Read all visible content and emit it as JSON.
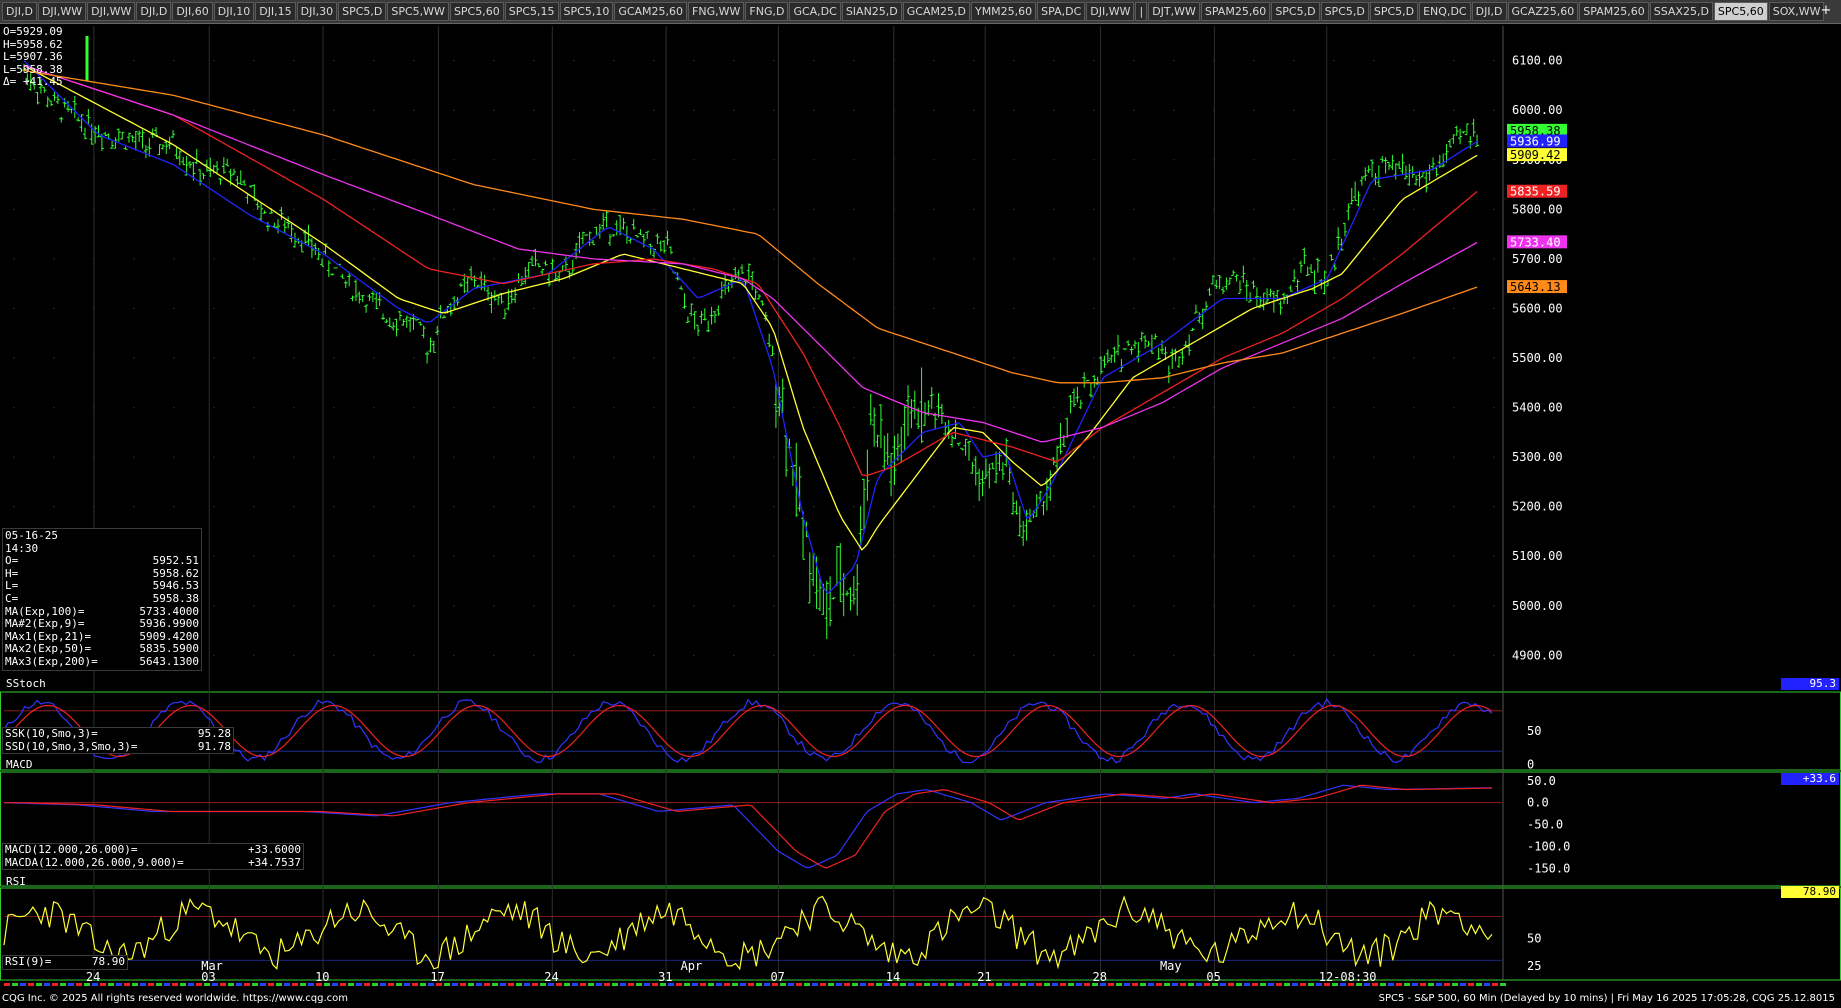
{
  "tabs": [
    "DJI,D",
    "DJI,WW",
    "DJI,WW",
    "DJI,D",
    "DJI,60",
    "DJI,10",
    "DJI,15",
    "DJI,30",
    "SPC5,D",
    "SPC5,WW",
    "SPC5,60",
    "SPC5,15",
    "SPC5,10",
    "GCAM25,60",
    "FNG,WW",
    "FNG,D",
    "GCA,DC",
    "SIAN25,D",
    "GCAM25,D",
    "YMM25,60",
    "SPA,DC",
    "DJI,WW",
    "|",
    "DJT,WW",
    "SPAM25,60",
    "SPC5,D",
    "SPC5,D",
    "SPC5,D",
    "ENQ,DC",
    "DJI,D",
    "GCAZ25,60",
    "SPAM25,60",
    "SSAX25,D",
    "SPC5,60",
    "SOX,WW"
  ],
  "active_tab_index": 33,
  "add_tab_label": "+",
  "header_ohlc": {
    "o": "O=5929.09",
    "h": "H=5958.62",
    "l": "L=5907.36",
    "l2": "L=5958.38",
    "delta": "Δ= +41.45"
  },
  "cursor_box": {
    "date": "05-16-25",
    "time": "14:30",
    "rows": [
      [
        "O=",
        "5952.51"
      ],
      [
        "H=",
        "5958.62"
      ],
      [
        "L=",
        "5946.53"
      ],
      [
        "C=",
        "5958.38"
      ],
      [
        "MA(Exp,100)=",
        "5733.4000"
      ],
      [
        "MA#2(Exp,9)=",
        "5936.9900"
      ],
      [
        "MAx1(Exp,21)=",
        "5909.4200"
      ],
      [
        "MAx2(Exp,50)=",
        "5835.5900"
      ],
      [
        "MAx3(Exp,200)=",
        "5643.1300"
      ]
    ]
  },
  "stoch_box": {
    "title": "SStoch",
    "rows": [
      [
        "SSK(10,Smo,3)=",
        "95.28"
      ],
      [
        "SSD(10,Smo,3,Smo,3)=",
        "91.78"
      ]
    ],
    "badge": "95.3"
  },
  "macd_box": {
    "title": "MACD",
    "rows": [
      [
        "MACD(12.000,26.000)=",
        "+33.6000"
      ],
      [
        "MACDA(12.000,26.000,9.000)=",
        "+34.7537"
      ]
    ],
    "badge": "+33.6"
  },
  "rsi_box": {
    "title": "RSI",
    "rows": [
      [
        "RSI(9)=",
        "78.90"
      ]
    ],
    "badge": "78.90"
  },
  "footer": {
    "left": "CQG Inc. © 2025 All rights reserved worldwide. https://www.cqg.com",
    "right": "SPC5 - S&P 500, 60 Min (Delayed by 10 mins) | Fri May 16 2025 17:05:28, CQG 25.12.8015"
  },
  "colors": {
    "bars": "#33ff33",
    "ema9": "#2222ff",
    "ema21": "#ffff33",
    "ema50": "#ee2222",
    "ema100": "#ee33ee",
    "ema200": "#ff8a1a",
    "grid": "#3a3a3a",
    "panel_border": "#33cc33"
  },
  "chart_data": [
    {
      "type": "candlestick",
      "name": "price",
      "ylim": [
        4830,
        6170
      ],
      "yticks": [
        4900,
        5000,
        5100,
        5200,
        5300,
        5400,
        5500,
        5600,
        5700,
        5800,
        5900,
        6000,
        6100
      ],
      "ytick_labels": [
        "4900.00",
        "5000.00",
        "5100.00",
        "5200.00",
        "5300.00",
        "5400.00",
        "5500.00",
        "5600.00",
        "5700.00",
        "5800.00",
        "5900.00",
        "6000.00",
        "6100.00"
      ],
      "x_labels": [
        {
          "pos": 0.06,
          "text": "24",
          "row": "lower"
        },
        {
          "pos": 0.137,
          "text": "Mar",
          "row": "upper"
        },
        {
          "pos": 0.137,
          "text": "03",
          "row": "lower"
        },
        {
          "pos": 0.213,
          "text": "10",
          "row": "lower"
        },
        {
          "pos": 0.29,
          "text": "17",
          "row": "lower"
        },
        {
          "pos": 0.366,
          "text": "24",
          "row": "lower"
        },
        {
          "pos": 0.442,
          "text": "31",
          "row": "lower"
        },
        {
          "pos": 0.457,
          "text": "Apr",
          "row": "upper"
        },
        {
          "pos": 0.517,
          "text": "07",
          "row": "lower"
        },
        {
          "pos": 0.594,
          "text": "14",
          "row": "lower"
        },
        {
          "pos": 0.655,
          "text": "21",
          "row": "lower"
        },
        {
          "pos": 0.732,
          "text": "28",
          "row": "lower"
        },
        {
          "pos": 0.777,
          "text": "May",
          "row": "upper"
        },
        {
          "pos": 0.808,
          "text": "05",
          "row": "lower"
        },
        {
          "pos": 0.883,
          "text": "12-08:30",
          "row": "lower"
        }
      ],
      "anchors": [
        [
          0,
          6080
        ],
        [
          0.02,
          6010
        ],
        [
          0.05,
          5960
        ],
        [
          0.08,
          5930
        ],
        [
          0.1,
          5930
        ],
        [
          0.12,
          5870
        ],
        [
          0.14,
          5880
        ],
        [
          0.16,
          5790
        ],
        [
          0.18,
          5760
        ],
        [
          0.2,
          5700
        ],
        [
          0.22,
          5640
        ],
        [
          0.24,
          5590
        ],
        [
          0.26,
          5570
        ],
        [
          0.27,
          5520
        ],
        [
          0.28,
          5590
        ],
        [
          0.3,
          5660
        ],
        [
          0.32,
          5610
        ],
        [
          0.34,
          5690
        ],
        [
          0.36,
          5660
        ],
        [
          0.375,
          5740
        ],
        [
          0.39,
          5770
        ],
        [
          0.41,
          5740
        ],
        [
          0.43,
          5720
        ],
        [
          0.44,
          5610
        ],
        [
          0.45,
          5560
        ],
        [
          0.47,
          5640
        ],
        [
          0.485,
          5670
        ],
        [
          0.495,
          5570
        ],
        [
          0.505,
          5420
        ],
        [
          0.515,
          5250
        ],
        [
          0.525,
          5100
        ],
        [
          0.535,
          4980
        ],
        [
          0.545,
          5050
        ],
        [
          0.555,
          5010
        ],
        [
          0.565,
          5380
        ],
        [
          0.58,
          5270
        ],
        [
          0.595,
          5400
        ],
        [
          0.61,
          5400
        ],
        [
          0.625,
          5330
        ],
        [
          0.64,
          5250
        ],
        [
          0.655,
          5300
        ],
        [
          0.665,
          5160
        ],
        [
          0.675,
          5180
        ],
        [
          0.685,
          5250
        ],
        [
          0.7,
          5400
        ],
        [
          0.72,
          5480
        ],
        [
          0.74,
          5530
        ],
        [
          0.755,
          5540
        ],
        [
          0.765,
          5480
        ],
        [
          0.78,
          5560
        ],
        [
          0.795,
          5650
        ],
        [
          0.81,
          5660
        ],
        [
          0.825,
          5620
        ],
        [
          0.84,
          5610
        ],
        [
          0.855,
          5690
        ],
        [
          0.87,
          5650
        ],
        [
          0.885,
          5810
        ],
        [
          0.9,
          5880
        ],
        [
          0.92,
          5880
        ],
        [
          0.935,
          5860
        ],
        [
          0.95,
          5910
        ],
        [
          0.96,
          5950
        ],
        [
          0.97,
          5958
        ]
      ],
      "ema_series": [
        {
          "key": "ema9",
          "anchors": [
            [
              0,
              6100
            ],
            [
              0.05,
              5950
            ],
            [
              0.1,
              5890
            ],
            [
              0.15,
              5790
            ],
            [
              0.2,
              5710
            ],
            [
              0.25,
              5600
            ],
            [
              0.27,
              5570
            ],
            [
              0.3,
              5640
            ],
            [
              0.35,
              5670
            ],
            [
              0.375,
              5730
            ],
            [
              0.39,
              5765
            ],
            [
              0.42,
              5720
            ],
            [
              0.45,
              5620
            ],
            [
              0.48,
              5660
            ],
            [
              0.5,
              5480
            ],
            [
              0.52,
              5180
            ],
            [
              0.535,
              5020
            ],
            [
              0.555,
              5080
            ],
            [
              0.57,
              5260
            ],
            [
              0.6,
              5350
            ],
            [
              0.625,
              5370
            ],
            [
              0.64,
              5300
            ],
            [
              0.655,
              5310
            ],
            [
              0.67,
              5170
            ],
            [
              0.685,
              5240
            ],
            [
              0.72,
              5460
            ],
            [
              0.76,
              5530
            ],
            [
              0.8,
              5620
            ],
            [
              0.84,
              5620
            ],
            [
              0.87,
              5660
            ],
            [
              0.9,
              5860
            ],
            [
              0.94,
              5880
            ],
            [
              0.97,
              5937
            ]
          ]
        },
        {
          "key": "ema21",
          "anchors": [
            [
              0,
              6090
            ],
            [
              0.05,
              6010
            ],
            [
              0.1,
              5930
            ],
            [
              0.15,
              5830
            ],
            [
              0.2,
              5730
            ],
            [
              0.25,
              5620
            ],
            [
              0.28,
              5590
            ],
            [
              0.32,
              5630
            ],
            [
              0.36,
              5660
            ],
            [
              0.4,
              5710
            ],
            [
              0.44,
              5680
            ],
            [
              0.48,
              5650
            ],
            [
              0.5,
              5560
            ],
            [
              0.52,
              5360
            ],
            [
              0.545,
              5180
            ],
            [
              0.56,
              5110
            ],
            [
              0.57,
              5160
            ],
            [
              0.59,
              5240
            ],
            [
              0.62,
              5360
            ],
            [
              0.64,
              5350
            ],
            [
              0.66,
              5290
            ],
            [
              0.68,
              5240
            ],
            [
              0.71,
              5340
            ],
            [
              0.74,
              5460
            ],
            [
              0.78,
              5530
            ],
            [
              0.82,
              5600
            ],
            [
              0.86,
              5640
            ],
            [
              0.88,
              5670
            ],
            [
              0.92,
              5820
            ],
            [
              0.97,
              5909
            ]
          ]
        },
        {
          "key": "ema50",
          "anchors": [
            [
              0,
              6090
            ],
            [
              0.1,
              5990
            ],
            [
              0.2,
              5820
            ],
            [
              0.27,
              5680
            ],
            [
              0.32,
              5650
            ],
            [
              0.38,
              5690
            ],
            [
              0.42,
              5700
            ],
            [
              0.46,
              5680
            ],
            [
              0.49,
              5650
            ],
            [
              0.52,
              5510
            ],
            [
              0.545,
              5360
            ],
            [
              0.56,
              5260
            ],
            [
              0.58,
              5280
            ],
            [
              0.62,
              5350
            ],
            [
              0.66,
              5320
            ],
            [
              0.69,
              5290
            ],
            [
              0.72,
              5360
            ],
            [
              0.76,
              5430
            ],
            [
              0.8,
              5500
            ],
            [
              0.84,
              5550
            ],
            [
              0.88,
              5620
            ],
            [
              0.92,
              5710
            ],
            [
              0.97,
              5836
            ]
          ]
        },
        {
          "key": "ema100",
          "anchors": [
            [
              0,
              6090
            ],
            [
              0.1,
              5990
            ],
            [
              0.2,
              5870
            ],
            [
              0.27,
              5790
            ],
            [
              0.33,
              5720
            ],
            [
              0.38,
              5700
            ],
            [
              0.44,
              5690
            ],
            [
              0.48,
              5660
            ],
            [
              0.5,
              5620
            ],
            [
              0.53,
              5530
            ],
            [
              0.56,
              5440
            ],
            [
              0.6,
              5390
            ],
            [
              0.64,
              5370
            ],
            [
              0.68,
              5330
            ],
            [
              0.72,
              5360
            ],
            [
              0.76,
              5410
            ],
            [
              0.8,
              5480
            ],
            [
              0.84,
              5530
            ],
            [
              0.88,
              5580
            ],
            [
              0.92,
              5650
            ],
            [
              0.97,
              5733
            ]
          ]
        },
        {
          "key": "ema200",
          "anchors": [
            [
              0,
              6080
            ],
            [
              0.1,
              6030
            ],
            [
              0.2,
              5950
            ],
            [
              0.3,
              5850
            ],
            [
              0.38,
              5800
            ],
            [
              0.44,
              5780
            ],
            [
              0.49,
              5750
            ],
            [
              0.53,
              5650
            ],
            [
              0.57,
              5560
            ],
            [
              0.62,
              5510
            ],
            [
              0.66,
              5470
            ],
            [
              0.69,
              5450
            ],
            [
              0.72,
              5450
            ],
            [
              0.76,
              5460
            ],
            [
              0.8,
              5490
            ],
            [
              0.84,
              5510
            ],
            [
              0.88,
              5550
            ],
            [
              0.92,
              5590
            ],
            [
              0.97,
              5643
            ]
          ]
        }
      ],
      "right_labels": [
        {
          "value": 5958.38,
          "text": "5958.38",
          "bg": "#33ff33",
          "fg": "#000"
        },
        {
          "value": 5936.99,
          "text": "5936.99",
          "bg": "#2222ff",
          "fg": "#fff"
        },
        {
          "value": 5909.42,
          "text": "5909.42",
          "bg": "#ffff33",
          "fg": "#000"
        },
        {
          "value": 5835.59,
          "text": "5835.59",
          "bg": "#ee2222",
          "fg": "#fff"
        },
        {
          "value": 5733.4,
          "text": "5733.40",
          "bg": "#ee33ee",
          "fg": "#fff"
        },
        {
          "value": 5643.13,
          "text": "5643.13",
          "bg": "#ff8a1a",
          "fg": "#000"
        }
      ]
    },
    {
      "type": "line",
      "name": "stochastic",
      "ylim": [
        -8,
        108
      ],
      "yticks": [
        0,
        50
      ],
      "ytick_labels": [
        "0",
        "50"
      ],
      "levels": [
        20,
        80
      ],
      "last_value": 95.28
    },
    {
      "type": "line",
      "name": "macd",
      "ylim": [
        -190,
        70
      ],
      "yticks": [
        -150,
        -100,
        -50,
        0,
        50
      ],
      "ytick_labels": [
        "-150.0",
        "-100.0",
        "-50.0",
        "0.0",
        "50.0"
      ],
      "last_value": 33.6
    },
    {
      "type": "line",
      "name": "rsi",
      "ylim": [
        12,
        96
      ],
      "yticks": [
        25,
        50
      ],
      "ytick_labels": [
        "25",
        "50"
      ],
      "levels": [
        30,
        70
      ],
      "last_value": 78.9
    }
  ]
}
